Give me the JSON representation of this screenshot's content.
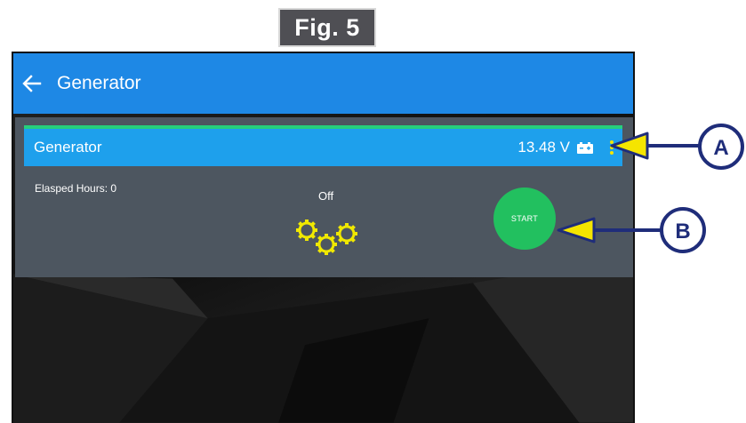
{
  "figure": {
    "label": "Fig. 5"
  },
  "app_bar": {
    "title": "Generator",
    "back_icon": "arrow-left-icon"
  },
  "generator_card": {
    "title": "Generator",
    "voltage": "13.48 V",
    "battery_icon": "battery-icon",
    "menu_icon": "more-vert-icon",
    "elapsed_hours": "Elasped Hours: 0",
    "status": "Off",
    "status_icon": "gears-icon",
    "start_label": "START"
  },
  "callouts": [
    {
      "letter": "A"
    },
    {
      "letter": "B"
    }
  ],
  "colors": {
    "app_bar": "#1e88e5",
    "card_header": "#1ea0ec",
    "header_accent": "#26d07c",
    "card_body": "#4d5660",
    "start_button": "#22c05f",
    "gears": "#f0e800",
    "callout_navy": "#1f2d7a",
    "callout_arrow": "#f5e500",
    "fig_label_bg": "#4f4f54"
  }
}
